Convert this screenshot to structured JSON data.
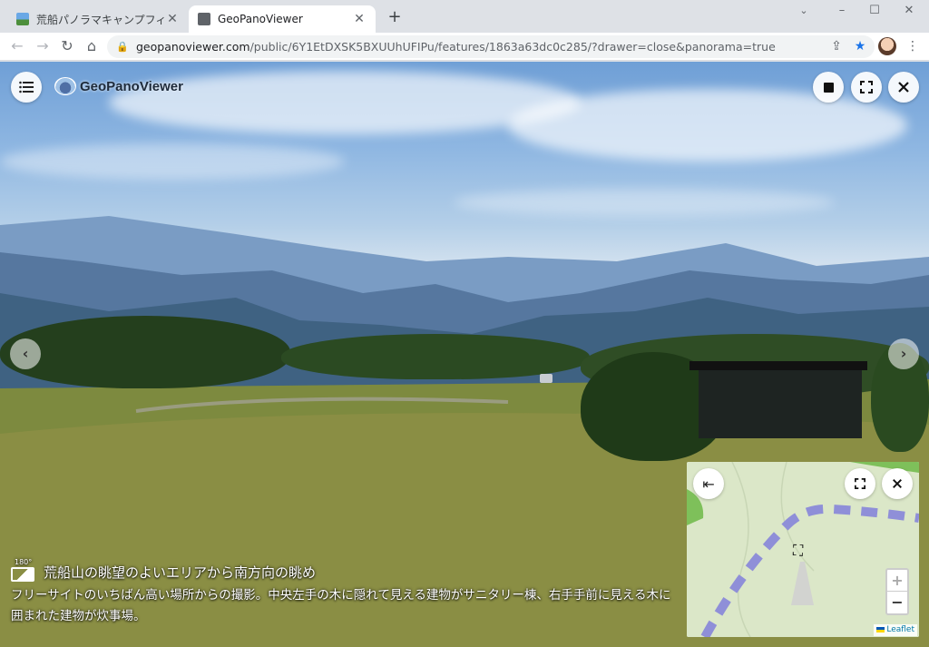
{
  "browser": {
    "tabs": [
      {
        "title": "荒船パノラマキャンプフィールド（旧内",
        "active": false,
        "icon": "panorama-favicon"
      },
      {
        "title": "GeoPanoViewer",
        "active": true,
        "icon": "globe-favicon"
      }
    ],
    "url_host": "geopanoviewer.com",
    "url_path": "/public/6Y1EtDXSK5BXUUhUFIPu/features/1863a63dc0c285/?drawer=close&panorama=true",
    "window_controls": {
      "minimize": "–",
      "maximize": "☐",
      "close": "✕"
    },
    "nav": {
      "back": "←",
      "forward": "→",
      "reload": "↻",
      "home": "⌂"
    },
    "icons": {
      "share": "share-icon",
      "bookmark": "star-icon",
      "menu": "kebab-menu-icon"
    }
  },
  "app": {
    "brand_name": "GeoPanoViewer",
    "controls": {
      "menu": "menu-icon",
      "stop": "stop-icon",
      "fullscreen": "fullscreen-icon",
      "close": "close-icon"
    },
    "prev_label": "‹",
    "next_label": "›"
  },
  "caption": {
    "badge": "180°",
    "title": "荒船山の眺望のよいエリアから南方向の眺め",
    "body": "フリーサイトのいちばん高い場所からの撮影。中央左手の木に隠れて見える建物がサニタリー棟、右手手前に見える木に囲まれた建物が炊事場。"
  },
  "minimap": {
    "collapse_label": "⇤",
    "zoom_in": "+",
    "zoom_out": "−",
    "attribution": "Leaflet",
    "colors": {
      "land": "#dbe7c8",
      "track": "#8f8fd8",
      "forest": "#7ec05a"
    }
  },
  "colors": {
    "accent": "#1a73e8",
    "bookmark_star": "#1a73e8"
  }
}
